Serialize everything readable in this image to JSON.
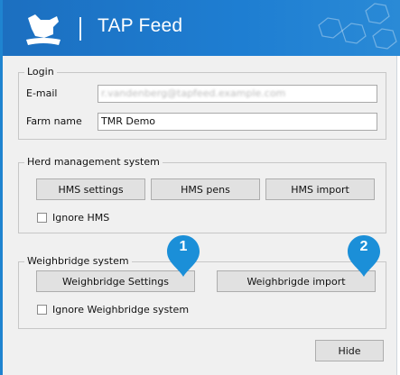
{
  "window": {
    "title": "TAP Feed",
    "colors": {
      "titlebar": "#1e7ed2",
      "marker": "#1b8fd8"
    }
  },
  "login": {
    "legend": "Login",
    "email_label": "E-mail",
    "email_value": "r.vandenberg@tapfeed.example.com",
    "farm_label": "Farm name",
    "farm_value": "TMR Demo"
  },
  "hms": {
    "legend": "Herd management system",
    "settings_button": "HMS settings",
    "pens_button": "HMS pens",
    "import_button": "HMS import",
    "ignore_label": "Ignore HMS"
  },
  "weighbridge": {
    "legend": "Weighbridge system",
    "settings_button": "Weighbridge Settings",
    "import_button": "Weighbrigde import",
    "ignore_label": "Ignore Weighbridge system",
    "markers": [
      "1",
      "2"
    ]
  },
  "footer": {
    "hide_button": "Hide"
  }
}
